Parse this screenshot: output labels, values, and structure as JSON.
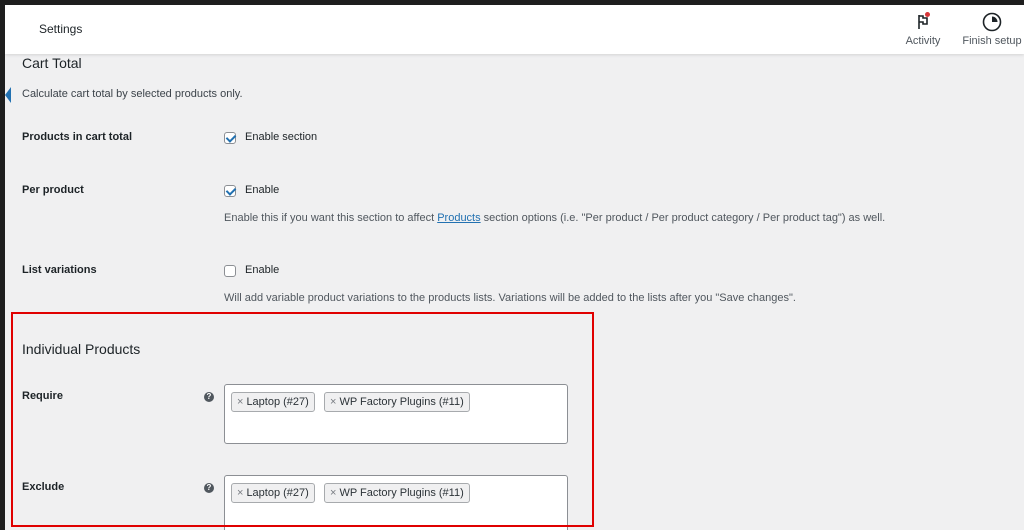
{
  "topbar": {
    "title": "Settings",
    "actions": [
      {
        "label": "Activity",
        "icon": "flag-icon"
      },
      {
        "label": "Finish setup",
        "icon": "progress-circle-icon"
      }
    ]
  },
  "cart_total": {
    "heading": "Cart Total",
    "description": "Calculate cart total by selected products only.",
    "rows": [
      {
        "label": "Products in cart total",
        "checkbox_label": "Enable section",
        "checked": true
      },
      {
        "label": "Per product",
        "checkbox_label": "Enable",
        "checked": true,
        "help_before": "Enable this if you want this section to affect ",
        "help_link": "Products",
        "help_after": " section options (i.e. \"Per product / Per product category / Per product tag\") as well."
      },
      {
        "label": "List variations",
        "checkbox_label": "Enable",
        "checked": false,
        "help": "Will add variable product variations to the products lists. Variations will be added to the lists after you \"Save changes\"."
      }
    ]
  },
  "individual_products": {
    "heading": "Individual Products",
    "require": {
      "label": "Require",
      "help_icon": "?",
      "chips": [
        {
          "remove": "×",
          "text": "Laptop (#27)"
        },
        {
          "remove": "×",
          "text": "WP Factory Plugins (#11)"
        }
      ]
    },
    "exclude": {
      "label": "Exclude",
      "help_icon": "?",
      "chips": [
        {
          "remove": "×",
          "text": "Laptop (#27)"
        },
        {
          "remove": "×",
          "text": "WP Factory Plugins (#11)"
        }
      ]
    }
  },
  "colors": {
    "accent": "#2271b1",
    "highlight_border": "#e00000",
    "notification_dot": "#d63638"
  }
}
